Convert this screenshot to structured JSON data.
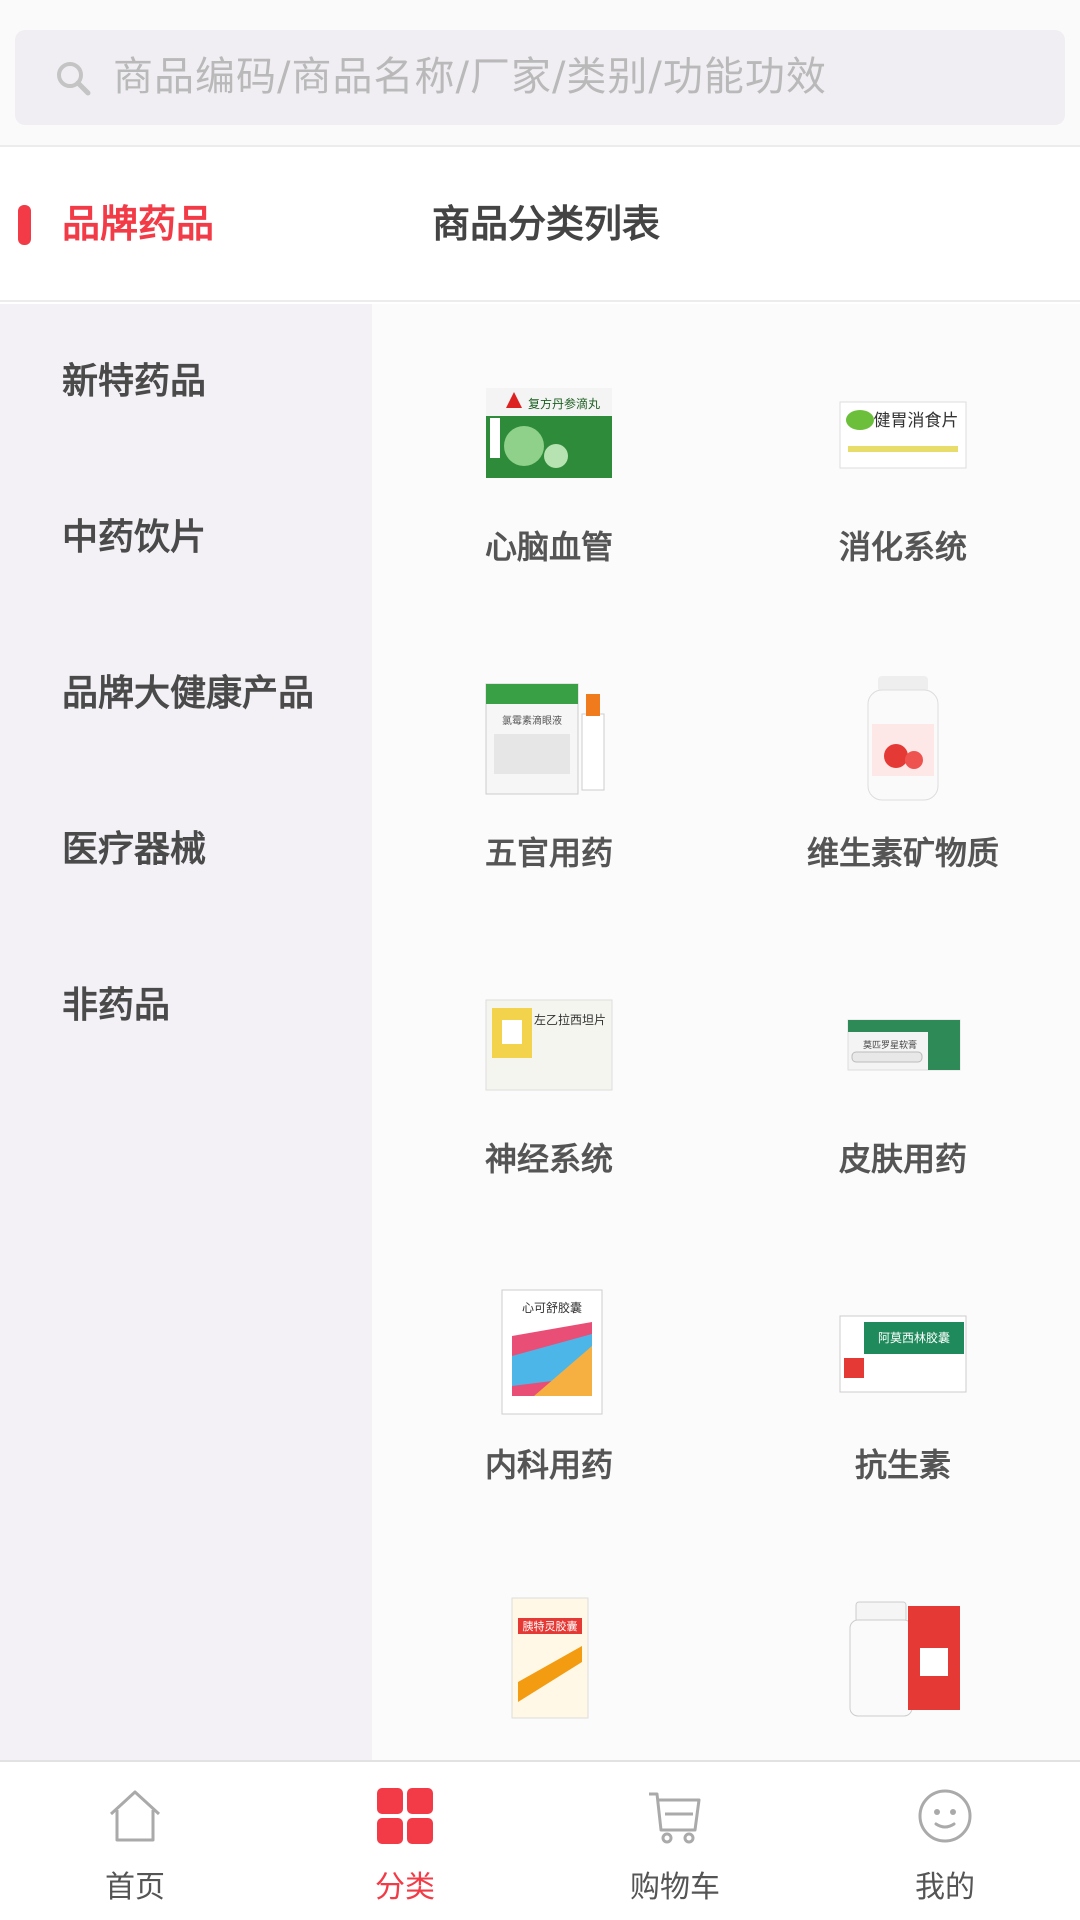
{
  "search": {
    "placeholder": "商品编码/商品名称/厂家/类别/功能功效",
    "icon": "search-icon"
  },
  "header": {
    "active_category": "品牌药品",
    "list_title": "商品分类列表"
  },
  "sidebar": {
    "items": [
      {
        "label": "新特药品"
      },
      {
        "label": "中药饮片"
      },
      {
        "label": "品牌大健康产品"
      },
      {
        "label": "医疗器械"
      },
      {
        "label": "非药品"
      }
    ]
  },
  "categories": [
    {
      "label": "心脑血管",
      "thumb": "green-box",
      "thumb_text": "复方丹参滴丸"
    },
    {
      "label": "消化系统",
      "thumb": "white-box",
      "thumb_text": "健胃消食片"
    },
    {
      "label": "五官用药",
      "thumb": "eyedrop-box",
      "thumb_text": "氯霉素滴眼液"
    },
    {
      "label": "维生素矿物质",
      "thumb": "bottle",
      "thumb_text": ""
    },
    {
      "label": "神经系统",
      "thumb": "yellow-box",
      "thumb_text": "左乙拉西坦片"
    },
    {
      "label": "皮肤用药",
      "thumb": "ointment-tube",
      "thumb_text": "莫匹罗星软膏"
    },
    {
      "label": "内科用药",
      "thumb": "colorful-box",
      "thumb_text": "心可舒胶囊"
    },
    {
      "label": "抗生素",
      "thumb": "capsule-box",
      "thumb_text": "阿莫西林胶囊"
    },
    {
      "label": "",
      "thumb": "orange-box",
      "thumb_text": "胰特灵胶囊"
    },
    {
      "label": "",
      "thumb": "bottle-red-box",
      "thumb_text": ""
    }
  ],
  "tabbar": {
    "items": [
      {
        "label": "首页",
        "icon": "home-icon"
      },
      {
        "label": "分类",
        "icon": "grid-icon"
      },
      {
        "label": "购物车",
        "icon": "cart-icon"
      },
      {
        "label": "我的",
        "icon": "profile-icon"
      }
    ],
    "active": "分类"
  },
  "colors": {
    "accent": "#f23b47",
    "sidebar_bg": "#f3f1f6",
    "search_bg": "#f1eef3"
  }
}
